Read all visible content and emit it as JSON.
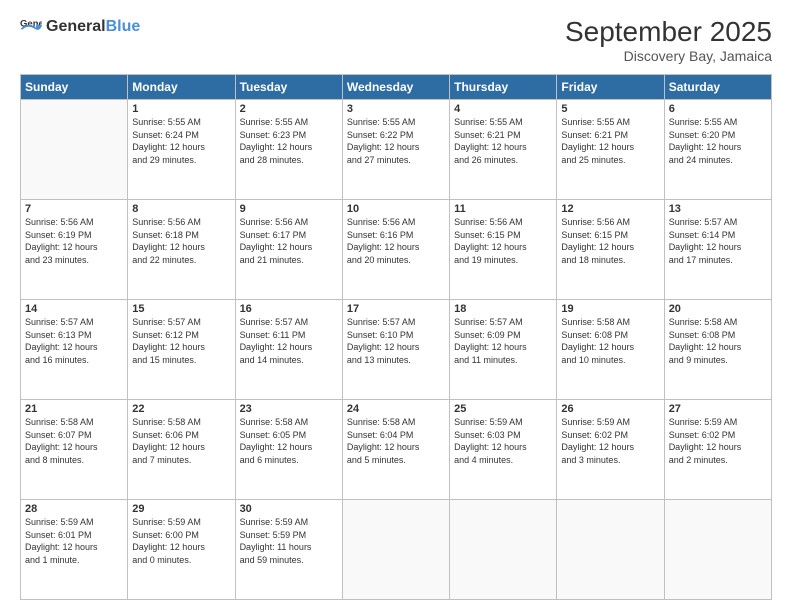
{
  "logo": {
    "general": "General",
    "blue": "Blue"
  },
  "title": "September 2025",
  "subtitle": "Discovery Bay, Jamaica",
  "days_header": [
    "Sunday",
    "Monday",
    "Tuesday",
    "Wednesday",
    "Thursday",
    "Friday",
    "Saturday"
  ],
  "weeks": [
    [
      {
        "day": "",
        "info": ""
      },
      {
        "day": "1",
        "info": "Sunrise: 5:55 AM\nSunset: 6:24 PM\nDaylight: 12 hours\nand 29 minutes."
      },
      {
        "day": "2",
        "info": "Sunrise: 5:55 AM\nSunset: 6:23 PM\nDaylight: 12 hours\nand 28 minutes."
      },
      {
        "day": "3",
        "info": "Sunrise: 5:55 AM\nSunset: 6:22 PM\nDaylight: 12 hours\nand 27 minutes."
      },
      {
        "day": "4",
        "info": "Sunrise: 5:55 AM\nSunset: 6:21 PM\nDaylight: 12 hours\nand 26 minutes."
      },
      {
        "day": "5",
        "info": "Sunrise: 5:55 AM\nSunset: 6:21 PM\nDaylight: 12 hours\nand 25 minutes."
      },
      {
        "day": "6",
        "info": "Sunrise: 5:55 AM\nSunset: 6:20 PM\nDaylight: 12 hours\nand 24 minutes."
      }
    ],
    [
      {
        "day": "7",
        "info": "Sunrise: 5:56 AM\nSunset: 6:19 PM\nDaylight: 12 hours\nand 23 minutes."
      },
      {
        "day": "8",
        "info": "Sunrise: 5:56 AM\nSunset: 6:18 PM\nDaylight: 12 hours\nand 22 minutes."
      },
      {
        "day": "9",
        "info": "Sunrise: 5:56 AM\nSunset: 6:17 PM\nDaylight: 12 hours\nand 21 minutes."
      },
      {
        "day": "10",
        "info": "Sunrise: 5:56 AM\nSunset: 6:16 PM\nDaylight: 12 hours\nand 20 minutes."
      },
      {
        "day": "11",
        "info": "Sunrise: 5:56 AM\nSunset: 6:15 PM\nDaylight: 12 hours\nand 19 minutes."
      },
      {
        "day": "12",
        "info": "Sunrise: 5:56 AM\nSunset: 6:15 PM\nDaylight: 12 hours\nand 18 minutes."
      },
      {
        "day": "13",
        "info": "Sunrise: 5:57 AM\nSunset: 6:14 PM\nDaylight: 12 hours\nand 17 minutes."
      }
    ],
    [
      {
        "day": "14",
        "info": "Sunrise: 5:57 AM\nSunset: 6:13 PM\nDaylight: 12 hours\nand 16 minutes."
      },
      {
        "day": "15",
        "info": "Sunrise: 5:57 AM\nSunset: 6:12 PM\nDaylight: 12 hours\nand 15 minutes."
      },
      {
        "day": "16",
        "info": "Sunrise: 5:57 AM\nSunset: 6:11 PM\nDaylight: 12 hours\nand 14 minutes."
      },
      {
        "day": "17",
        "info": "Sunrise: 5:57 AM\nSunset: 6:10 PM\nDaylight: 12 hours\nand 13 minutes."
      },
      {
        "day": "18",
        "info": "Sunrise: 5:57 AM\nSunset: 6:09 PM\nDaylight: 12 hours\nand 11 minutes."
      },
      {
        "day": "19",
        "info": "Sunrise: 5:58 AM\nSunset: 6:08 PM\nDaylight: 12 hours\nand 10 minutes."
      },
      {
        "day": "20",
        "info": "Sunrise: 5:58 AM\nSunset: 6:08 PM\nDaylight: 12 hours\nand 9 minutes."
      }
    ],
    [
      {
        "day": "21",
        "info": "Sunrise: 5:58 AM\nSunset: 6:07 PM\nDaylight: 12 hours\nand 8 minutes."
      },
      {
        "day": "22",
        "info": "Sunrise: 5:58 AM\nSunset: 6:06 PM\nDaylight: 12 hours\nand 7 minutes."
      },
      {
        "day": "23",
        "info": "Sunrise: 5:58 AM\nSunset: 6:05 PM\nDaylight: 12 hours\nand 6 minutes."
      },
      {
        "day": "24",
        "info": "Sunrise: 5:58 AM\nSunset: 6:04 PM\nDaylight: 12 hours\nand 5 minutes."
      },
      {
        "day": "25",
        "info": "Sunrise: 5:59 AM\nSunset: 6:03 PM\nDaylight: 12 hours\nand 4 minutes."
      },
      {
        "day": "26",
        "info": "Sunrise: 5:59 AM\nSunset: 6:02 PM\nDaylight: 12 hours\nand 3 minutes."
      },
      {
        "day": "27",
        "info": "Sunrise: 5:59 AM\nSunset: 6:02 PM\nDaylight: 12 hours\nand 2 minutes."
      }
    ],
    [
      {
        "day": "28",
        "info": "Sunrise: 5:59 AM\nSunset: 6:01 PM\nDaylight: 12 hours\nand 1 minute."
      },
      {
        "day": "29",
        "info": "Sunrise: 5:59 AM\nSunset: 6:00 PM\nDaylight: 12 hours\nand 0 minutes."
      },
      {
        "day": "30",
        "info": "Sunrise: 5:59 AM\nSunset: 5:59 PM\nDaylight: 11 hours\nand 59 minutes."
      },
      {
        "day": "",
        "info": ""
      },
      {
        "day": "",
        "info": ""
      },
      {
        "day": "",
        "info": ""
      },
      {
        "day": "",
        "info": ""
      }
    ]
  ]
}
